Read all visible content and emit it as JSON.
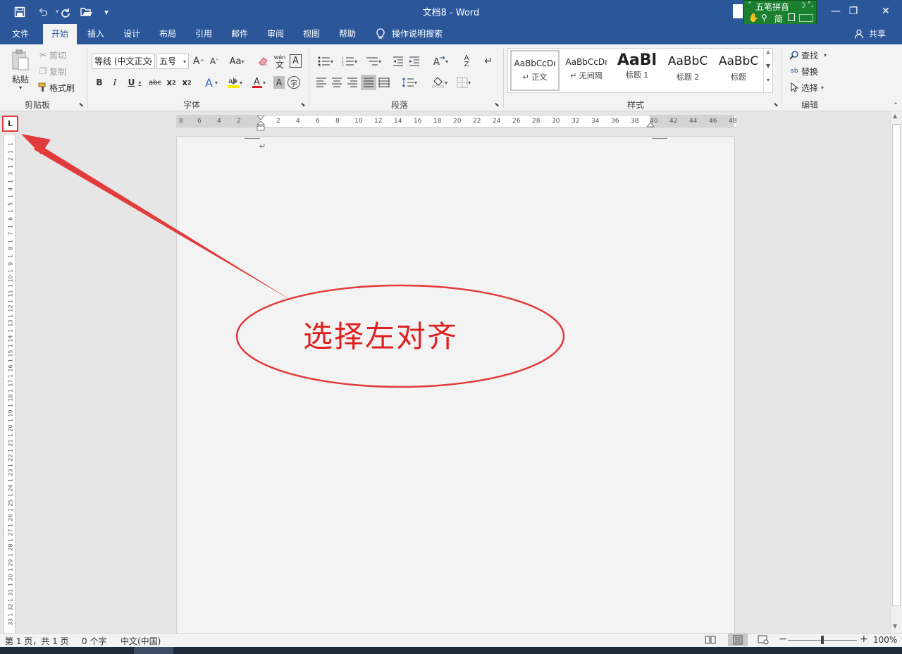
{
  "app": {
    "title": "文档8  -  Word"
  },
  "qat": {
    "save_icon": "save-icon",
    "undo_icon": "undo-icon",
    "redo_icon": "redo-icon",
    "open_icon": "open-icon",
    "customize_icon": "customize-qat-icon"
  },
  "window": {
    "minimize": "—",
    "restore": "❐",
    "close": "✕"
  },
  "ime": {
    "name": "五笔拼音",
    "mode": "简",
    "moon": "☽",
    "dots": "°,"
  },
  "tabs": [
    "文件",
    "开始",
    "插入",
    "设计",
    "布局",
    "引用",
    "邮件",
    "审阅",
    "视图",
    "帮助"
  ],
  "tell_me": "操作说明搜索",
  "share": "共享",
  "clipboard": {
    "paste": "粘贴",
    "cut": "剪切",
    "copy": "复制",
    "format_painter": "格式刷",
    "label": "剪贴板"
  },
  "font": {
    "name": "等线 (中文正文",
    "size": "五号",
    "label": "字体",
    "aa": "Aa",
    "wen": "wén",
    "wen2": "文"
  },
  "paragraph": {
    "label": "段落"
  },
  "styles": {
    "label": "样式",
    "items": [
      {
        "preview": "AaBbCcDı",
        "name": "↵ 正文"
      },
      {
        "preview": "AaBbCcDı",
        "name": "↵ 无间隔"
      },
      {
        "preview": "AaBl",
        "name": "标题 1"
      },
      {
        "preview": "AaBbC",
        "name": "标题 2"
      },
      {
        "preview": "AaBbC",
        "name": "标题"
      }
    ]
  },
  "editing": {
    "find": "查找",
    "replace": "替换",
    "select": "选择",
    "label": "编辑"
  },
  "ruler": {
    "h_numbers": [
      "8",
      "6",
      "4",
      "2",
      "2",
      "4",
      "6",
      "8",
      "10",
      "12",
      "14",
      "16",
      "18",
      "20",
      "22",
      "24",
      "26",
      "28",
      "30",
      "32",
      "34",
      "36",
      "38",
      "40",
      "42",
      "44",
      "46",
      "48"
    ],
    "v_numbers": [
      "1",
      "1",
      "2",
      "1",
      "3",
      "1",
      "4",
      "1",
      "5",
      "1",
      "6",
      "1",
      "7",
      "1",
      "8",
      "1",
      "9",
      "1",
      "10",
      "1",
      "11",
      "1",
      "12",
      "1",
      "13",
      "1",
      "14",
      "1",
      "15",
      "1",
      "16",
      "1",
      "17",
      "1",
      "18",
      "1",
      "19",
      "1",
      "20",
      "1",
      "21",
      "1",
      "22",
      "1",
      "23",
      "1",
      "24",
      "1",
      "25",
      "1",
      "26",
      "1",
      "27",
      "1",
      "28",
      "1",
      "29",
      "1",
      "30",
      "1",
      "31",
      "1",
      "32",
      "1",
      "33"
    ],
    "tab_selector": "L"
  },
  "document": {
    "paragraph_mark": "↵"
  },
  "annotation": {
    "text": "选择左对齐",
    "color": "#e02020"
  },
  "status": {
    "page": "第 1 页，共 1 页",
    "words": "0 个字",
    "language": "中文(中国)",
    "zoom": "100%",
    "zoom_minus": "−",
    "zoom_plus": "+"
  },
  "colors": {
    "accent": "#2b579a",
    "ribbon": "#f3f3f3",
    "annotation": "#e02020"
  }
}
